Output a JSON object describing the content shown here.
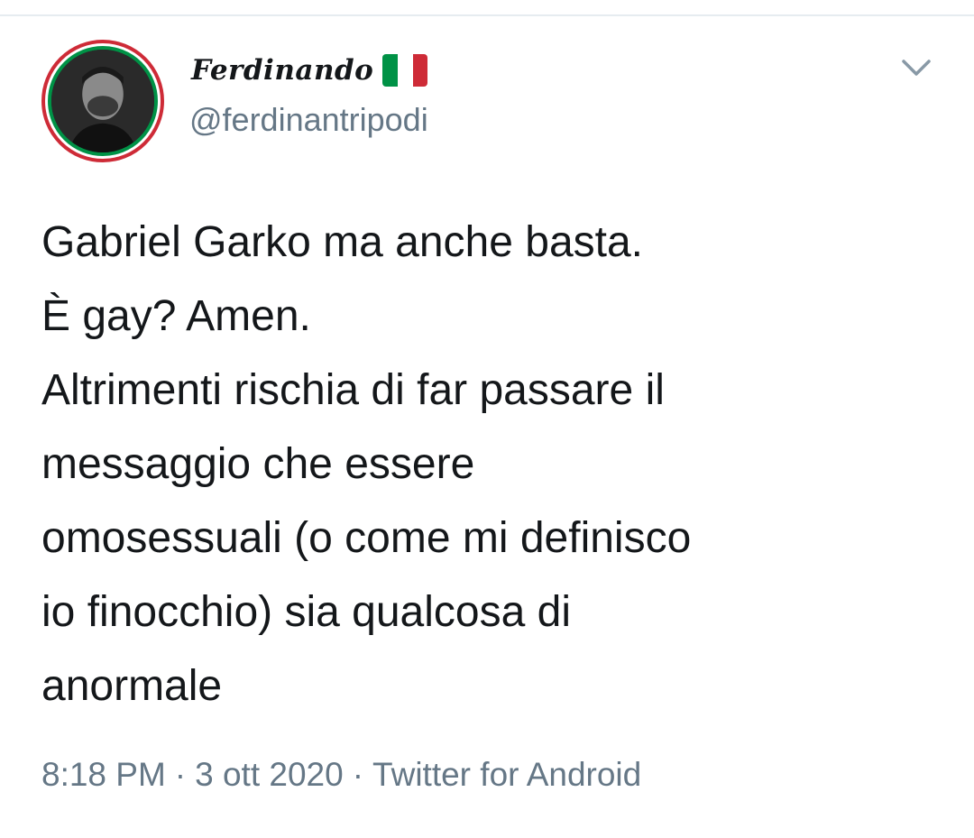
{
  "tweet": {
    "author": {
      "display_name": "Ferdinando",
      "handle": "@ferdinantripodi",
      "avatar_icon": "profile-photo",
      "flag_icon": "italy-flag",
      "flag_colors": [
        "#009246",
        "#ffffff",
        "#ce2b37"
      ]
    },
    "menu_icon": "chevron-down-icon",
    "text_lines": [
      "Gabriel Garko ma anche basta.",
      "È gay? Amen.",
      "Altrimenti rischia di far passare il",
      "messaggio che essere",
      "omosessuali (o come mi definisco",
      "io finocchio) sia qualcosa di",
      "anormale"
    ],
    "meta": {
      "time": "8:18 PM",
      "separator": "·",
      "date": "3 ott 2020",
      "source": "Twitter for Android"
    }
  },
  "colors": {
    "text_primary": "#14171a",
    "text_secondary": "#657786",
    "divider": "#e6ecf0"
  }
}
